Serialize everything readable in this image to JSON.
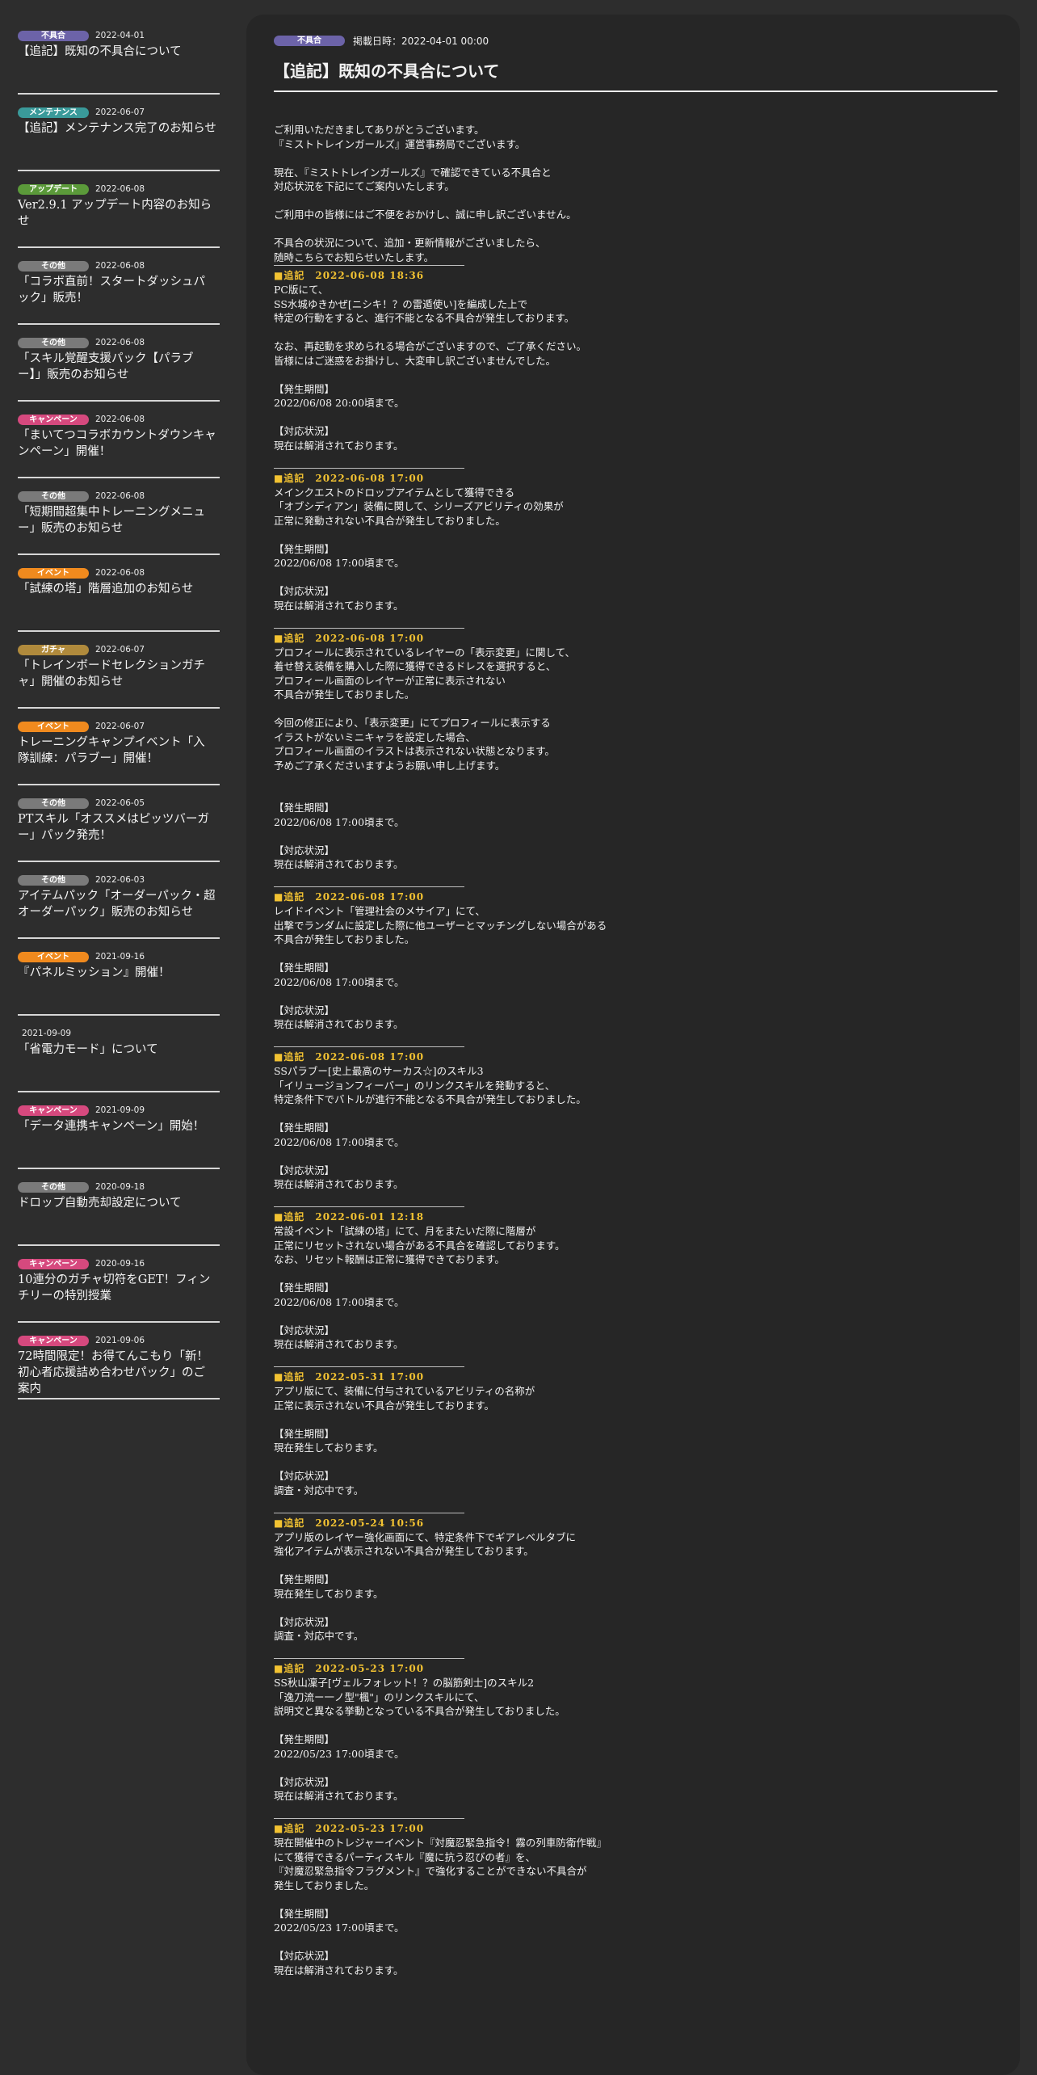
{
  "colors": {
    "badge_fuguai": "#6c63a8",
    "badge_maintenance": "#3a9a9a",
    "badge_update": "#5b9a3a",
    "badge_other": "#7a7a7a",
    "badge_campaign": "#d6497e",
    "badge_event": "#f08a1e",
    "badge_gacha": "#b08a3c",
    "accent_update_heading": "#f2c232"
  },
  "sidebar": {
    "items": [
      {
        "badge": "不具合",
        "badge_color": "#6c63a8",
        "date": "2022-04-01",
        "title": "【追記】既知の不具合について"
      },
      {
        "badge": "メンテナンス",
        "badge_color": "#3a9a9a",
        "date": "2022-06-07",
        "title": "【追記】メンテナンス完了のお知らせ"
      },
      {
        "badge": "アップデート",
        "badge_color": "#5b9a3a",
        "date": "2022-06-08",
        "title": "Ver2.9.1 アップデート内容のお知らせ"
      },
      {
        "badge": "その他",
        "badge_color": "#7a7a7a",
        "date": "2022-06-08",
        "title": "「コラボ直前！スタートダッシュパック」販売！"
      },
      {
        "badge": "その他",
        "badge_color": "#7a7a7a",
        "date": "2022-06-08",
        "title": "「スキル覚醒支援パック【パラブー】」販売のお知らせ"
      },
      {
        "badge": "キャンペーン",
        "badge_color": "#d6497e",
        "date": "2022-06-08",
        "title": "「まいてつコラボカウントダウンキャンペーン」開催！"
      },
      {
        "badge": "その他",
        "badge_color": "#7a7a7a",
        "date": "2022-06-08",
        "title": "「短期間超集中トレーニングメニュー」販売のお知らせ"
      },
      {
        "badge": "イベント",
        "badge_color": "#f08a1e",
        "date": "2022-06-08",
        "title": "「試練の塔」階層追加のお知らせ"
      },
      {
        "badge": "ガチャ",
        "badge_color": "#b08a3c",
        "date": "2022-06-07",
        "title": "「トレインボードセレクションガチャ」開催のお知らせ"
      },
      {
        "badge": "イベント",
        "badge_color": "#f08a1e",
        "date": "2022-06-07",
        "title": "トレーニングキャンプイベント「入隊訓練：パラブー」開催！"
      },
      {
        "badge": "その他",
        "badge_color": "#7a7a7a",
        "date": "2022-06-05",
        "title": "PTスキル「オススメはピッツバーガー」パック発売！"
      },
      {
        "badge": "その他",
        "badge_color": "#7a7a7a",
        "date": "2022-06-03",
        "title": "アイテムパック「オーダーパック・超オーダーパック」販売のお知らせ"
      },
      {
        "badge": "イベント",
        "badge_color": "#f08a1e",
        "date": "2021-09-16",
        "title": "『パネルミッション』開催！"
      },
      {
        "badge": "",
        "badge_color": "",
        "date": "2021-09-09",
        "title": "「省電力モード」について"
      },
      {
        "badge": "キャンペーン",
        "badge_color": "#d6497e",
        "date": "2021-09-09",
        "title": "「データ連携キャンペーン」開始！"
      },
      {
        "badge": "その他",
        "badge_color": "#7a7a7a",
        "date": "2020-09-18",
        "title": "ドロップ自動売却設定について"
      },
      {
        "badge": "キャンペーン",
        "badge_color": "#d6497e",
        "date": "2020-09-16",
        "title": "10連分のガチャ切符をGET！フィンチリーの特別授業"
      },
      {
        "badge": "キャンペーン",
        "badge_color": "#d6497e",
        "date": "2021-09-06",
        "title": "72時間限定！お得てんこもり「新！初心者応援詰め合わせパック」のご案内"
      }
    ]
  },
  "article": {
    "badge": "不具合",
    "posted": "掲載日時：2022-04-01 00:00",
    "title": "【追記】既知の不具合について",
    "intro": [
      "ご利用いただきましてありがとうございます。\n『ミストトレインガールズ』運営事務局でございます。",
      "現在、『ミストトレインガールズ』で確認できている不具合と\n対応状況を下記にてご案内いたします。",
      "ご利用中の皆様にはご不便をおかけし、誠に申し訳ございません。",
      "不具合の状況について、追加・更新情報がございましたら、\n随時こちらでお知らせいたします。"
    ],
    "updates": [
      {
        "heading": "■追記　2022-06-08 18:36",
        "body": [
          "PC版にて、\nSS水城ゆきかぜ[ニシキ！？の雷遁使い]を編成した上で\n特定の行動をすると、進行不能となる不具合が発生しております。",
          "なお、再起動を求められる場合がございますので、ご了承ください。\n皆様にはご迷惑をお掛けし、大変申し訳ございませんでした。"
        ],
        "period_label": "【発生期間】",
        "period": "2022/06/08 20:00頃まで。",
        "status_label": "【対応状況】",
        "status": "現在は解消されております。"
      },
      {
        "heading": "■追記　2022-06-08 17:00",
        "body": [
          "メインクエストのドロップアイテムとして獲得できる\n「オブシディアン」装備に関して、シリーズアビリティの効果が\n正常に発動されない不具合が発生しておりました。"
        ],
        "period_label": "【発生期間】",
        "period": "2022/06/08 17:00頃まで。",
        "status_label": "【対応状況】",
        "status": "現在は解消されております。"
      },
      {
        "heading": "■追記　2022-06-08 17:00",
        "body": [
          "プロフィールに表示されているレイヤーの「表示変更」に関して、\n着せ替え装備を購入した際に獲得できるドレスを選択すると、\nプロフィール画面のレイヤーが正常に表示されない\n不具合が発生しておりました。",
          "今回の修正により、「表示変更」にてプロフィールに表示する\nイラストがないミニキャラを設定した場合、\nプロフィール画面のイラストは表示されない状態となります。\n予めご了承くださいますようお願い申し上げます。",
          ""
        ],
        "period_label": "【発生期間】",
        "period": "2022/06/08 17:00頃まで。",
        "status_label": "【対応状況】",
        "status": "現在は解消されております。"
      },
      {
        "heading": "■追記　2022-06-08 17:00",
        "body": [
          "レイドイベント「管理社会のメサイア」にて、\n出撃でランダムに設定した際に他ユーザーとマッチングしない場合がある\n不具合が発生しておりました。"
        ],
        "period_label": "【発生期間】",
        "period": "2022/06/08 17:00頃まで。",
        "status_label": "【対応状況】",
        "status": "現在は解消されております。"
      },
      {
        "heading": "■追記　2022-06-08 17:00",
        "body": [
          "SSパラブー[史上最高のサーカス☆]のスキル3\n「イリュージョンフィーバー」のリンクスキルを発動すると、\n特定条件下でバトルが進行不能となる不具合が発生しておりました。"
        ],
        "period_label": "【発生期間】",
        "period": "2022/06/08 17:00頃まで。",
        "status_label": "【対応状況】",
        "status": "現在は解消されております。"
      },
      {
        "heading": "■追記　2022-06-01 12:18",
        "body": [
          "常設イベント「試練の塔」にて、月をまたいだ際に階層が\n正常にリセットされない場合がある不具合を確認しております。\nなお、リセット報酬は正常に獲得できております。"
        ],
        "period_label": "【発生期間】",
        "period": "2022/06/08 17:00頃まで。",
        "status_label": "【対応状況】",
        "status": "現在は解消されております。"
      },
      {
        "heading": "■追記　2022-05-31 17:00",
        "body": [
          "アプリ版にて、装備に付与されているアビリティの名称が\n正常に表示されない不具合が発生しております。"
        ],
        "period_label": "【発生期間】",
        "period": "現在発生しております。",
        "status_label": "【対応状況】",
        "status": "調査・対応中です。"
      },
      {
        "heading": "■追記　2022-05-24 10:56",
        "body": [
          "アプリ版のレイヤー強化画面にて、特定条件下でギアレベルタブに\n強化アイテムが表示されない不具合が発生しております。"
        ],
        "period_label": "【発生期間】",
        "period": "現在発生しております。",
        "status_label": "【対応状況】",
        "status": "調査・対応中です。"
      },
      {
        "heading": "■追記　2022-05-23 17:00",
        "body": [
          "SS秋山凜子[ヴェルフォレット！？の脳筋剣士]のスキル2\n「逸刀流ー一ノ型\"楓\"」のリンクスキルにて、\n説明文と異なる挙動となっている不具合が発生しておりました。"
        ],
        "period_label": "【発生期間】",
        "period": "2022/05/23 17:00頃まで。",
        "status_label": "【対応状況】",
        "status": "現在は解消されております。"
      },
      {
        "heading": "■追記　2022-05-23 17:00",
        "body": [
          "現在開催中のトレジャーイベント『対魔忍緊急指令！霧の列車防衛作戦』\nにて獲得できるパーティスキル『魔に抗う忍びの者』を、\n『対魔忍緊急指令フラグメント』で強化することができない不具合が\n発生しておりました。"
        ],
        "period_label": "【発生期間】",
        "period": "2022/05/23 17:00頃まで。",
        "status_label": "【対応状況】",
        "status": "現在は解消されております。"
      }
    ]
  }
}
